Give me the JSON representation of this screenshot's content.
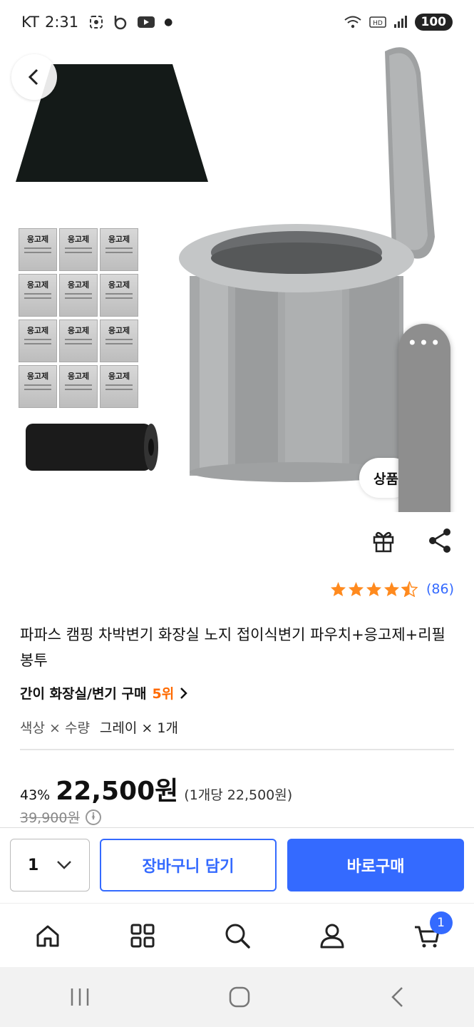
{
  "status": {
    "carrier": "KT",
    "time": "2:31",
    "battery": "100"
  },
  "hero": {
    "detail_chip": "상품"
  },
  "rating": {
    "count": "(86)",
    "stars": 4.5
  },
  "product": {
    "title": "파파스 캠핑 차박변기 화장실 노지 접이식변기 파우치+응고제+리필봉투",
    "rank_category": "간이 화장실/변기 구매",
    "rank_number": "5위",
    "option_label": "색상 × 수량",
    "option_value": "그레이 × 1개",
    "discount": "43%",
    "price": "22,500원",
    "unit_price": "(1개당 22,500원)",
    "original_price": "39,900원",
    "pack_label": "응고제"
  },
  "buybar": {
    "quantity": "1",
    "cart_label": "장바구니 담기",
    "buy_label": "바로구매"
  },
  "nav": {
    "cart_badge": "1"
  },
  "colors": {
    "accent": "#346aff",
    "rank": "#ff6a00",
    "star": "#ff8a1e"
  }
}
